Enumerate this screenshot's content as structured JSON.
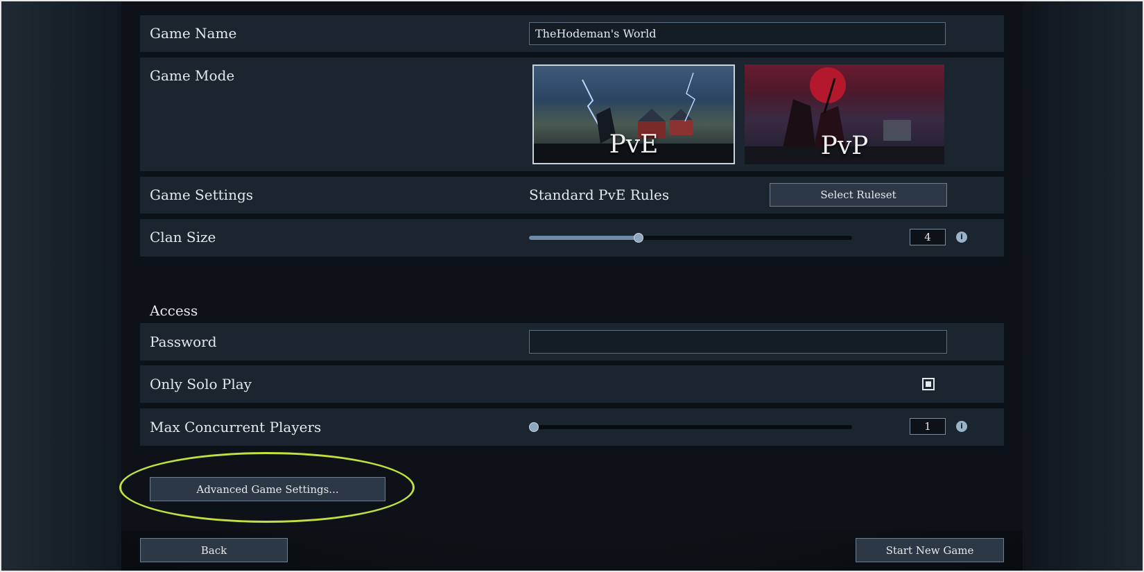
{
  "settings": {
    "game_name_label": "Game Name",
    "game_name_value": "TheHodeman's World",
    "game_mode_label": "Game Mode",
    "modes": [
      {
        "label": "PvE",
        "selected": true
      },
      {
        "label": "PvP",
        "selected": false
      }
    ],
    "game_settings_label": "Game Settings",
    "ruleset_value": "Standard PvE Rules",
    "select_ruleset_label": "Select Ruleset",
    "clan_size_label": "Clan Size",
    "clan_size_value": "4",
    "clan_size_fraction": 0.34
  },
  "access": {
    "section_label": "Access",
    "password_label": "Password",
    "password_value": "",
    "only_solo_label": "Only Solo Play",
    "only_solo_checked": true,
    "max_players_label": "Max Concurrent Players",
    "max_players_value": "1",
    "max_players_fraction": 0.0
  },
  "advanced_button_label": "Advanced Game Settings...",
  "footer": {
    "back_label": "Back",
    "start_label": "Start New Game"
  },
  "colors": {
    "highlight": "#c5e03c",
    "row_bg": "#1b2530",
    "slider_fill": "#6f8aa6"
  },
  "icons": {
    "info": "info-icon"
  }
}
